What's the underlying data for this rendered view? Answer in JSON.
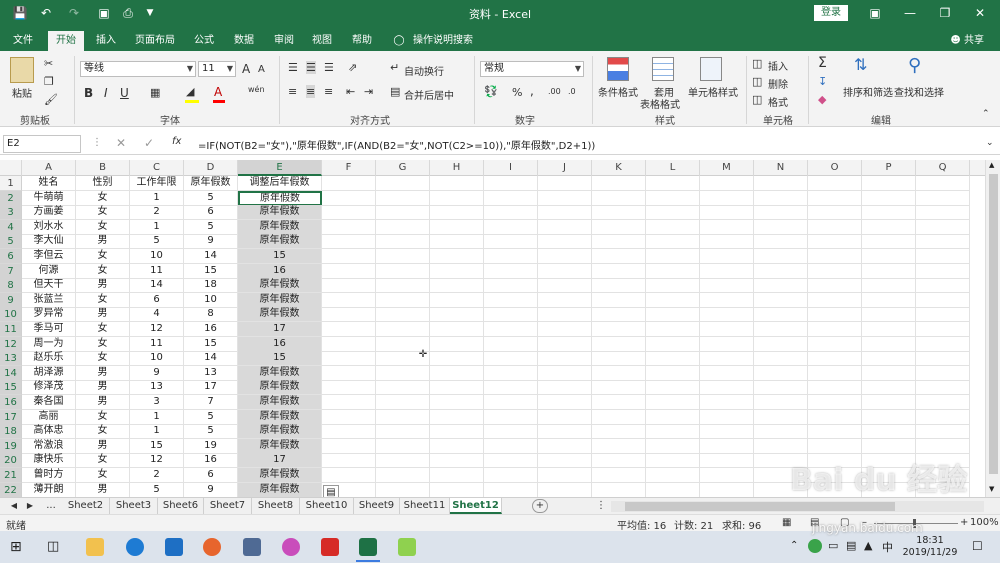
{
  "app": {
    "title": "资料 - Excel",
    "login_label": "登录",
    "share_label": "共享",
    "search_hint": "操作说明搜索"
  },
  "tabs": [
    "文件",
    "开始",
    "插入",
    "页面布局",
    "公式",
    "数据",
    "审阅",
    "视图",
    "帮助"
  ],
  "active_tab": "开始",
  "ribbon": {
    "paste_label": "粘贴",
    "clipboard_label": "剪贴板",
    "font_name": "等线",
    "font_size": "11",
    "font_group_label": "字体",
    "wrap_text_label": "自动换行",
    "merge_label": "合并后居中",
    "align_group_label": "对齐方式",
    "number_format": "常规",
    "number_group_label": "数字",
    "cond_format_label": "条件格式",
    "table_format_label_1": "套用",
    "table_format_label_2": "表格格式",
    "cell_styles_label": "单元格样式",
    "styles_group_label": "样式",
    "insert_label": "插入",
    "delete_label": "删除",
    "format_label": "格式",
    "cells_group_label": "单元格",
    "sort_filter_label": "排序和筛选",
    "find_select_label": "查找和选择",
    "editing_group_label": "编辑",
    "bold_label": "B",
    "italic_label": "I",
    "underline_label": "U",
    "font_grow_label": "A",
    "font_shrink_label": "A",
    "font_color_label": "A",
    "percent_label": "%",
    "comma_label": ",",
    "wen_label": "wén",
    "fx_label": "fx"
  },
  "formula_bar": {
    "name_box": "E2",
    "formula": "=IF(NOT(B2=\"女\"),\"原年假数\",IF(AND(B2=\"女\",NOT(C2>=10)),\"原年假数\",D2+1))"
  },
  "columns": [
    "A",
    "B",
    "C",
    "D",
    "E",
    "F",
    "G",
    "H",
    "I",
    "J",
    "K",
    "L",
    "M",
    "N",
    "O",
    "P",
    "Q"
  ],
  "headers": [
    "姓名",
    "性别",
    "工作年限",
    "原年假数",
    "调整后年假数"
  ],
  "rows": [
    [
      "牛萌萌",
      "女",
      "1",
      "5",
      "原年假数"
    ],
    [
      "方画姜",
      "女",
      "2",
      "6",
      "原年假数"
    ],
    [
      "刘水水",
      "女",
      "1",
      "5",
      "原年假数"
    ],
    [
      "李大仙",
      "男",
      "5",
      "9",
      "原年假数"
    ],
    [
      "李但云",
      "女",
      "10",
      "14",
      "15"
    ],
    [
      "何源",
      "女",
      "11",
      "15",
      "16"
    ],
    [
      "但天干",
      "男",
      "14",
      "18",
      "原年假数"
    ],
    [
      "张蓝兰",
      "女",
      "6",
      "10",
      "原年假数"
    ],
    [
      "罗异常",
      "男",
      "4",
      "8",
      "原年假数"
    ],
    [
      "季马可",
      "女",
      "12",
      "16",
      "17"
    ],
    [
      "周一为",
      "女",
      "11",
      "15",
      "16"
    ],
    [
      "赵乐乐",
      "女",
      "10",
      "14",
      "15"
    ],
    [
      "胡泽源",
      "男",
      "9",
      "13",
      "原年假数"
    ],
    [
      "修泽茂",
      "男",
      "13",
      "17",
      "原年假数"
    ],
    [
      "秦各国",
      "男",
      "3",
      "7",
      "原年假数"
    ],
    [
      "高丽",
      "女",
      "1",
      "5",
      "原年假数"
    ],
    [
      "高体忠",
      "女",
      "1",
      "5",
      "原年假数"
    ],
    [
      "常激浪",
      "男",
      "15",
      "19",
      "原年假数"
    ],
    [
      "康快乐",
      "女",
      "12",
      "16",
      "17"
    ],
    [
      "曾时方",
      "女",
      "2",
      "6",
      "原年假数"
    ],
    [
      "薄开朗",
      "男",
      "5",
      "9",
      "原年假数"
    ]
  ],
  "row_numbers": [
    "1",
    "2",
    "3",
    "4",
    "5",
    "6",
    "7",
    "8",
    "9",
    "10",
    "11",
    "12",
    "13",
    "14",
    "15",
    "16",
    "17",
    "18",
    "19",
    "20",
    "21",
    "22"
  ],
  "sheets": [
    "Sheet2",
    "Sheet3",
    "Sheet6",
    "Sheet7",
    "Sheet8",
    "Sheet10",
    "Sheet9",
    "Sheet11",
    "Sheet12"
  ],
  "active_sheet": "Sheet12",
  "sheet_nav_ellipsis": "...",
  "add_sheet_label": "+",
  "status": {
    "mode": "就绪",
    "average": "平均值: 16",
    "count": "计数: 21",
    "sum": "求和: 96",
    "zoom": "100%"
  },
  "taskbar": {
    "ime": "中",
    "time": "18:31",
    "date": "2019/11/29"
  },
  "watermark": "Bai du 经验",
  "watermark_sub": "jingyan.baidu.com",
  "colors": {
    "excel_green": "#217346",
    "selected_fill": "#d9d9d9"
  }
}
